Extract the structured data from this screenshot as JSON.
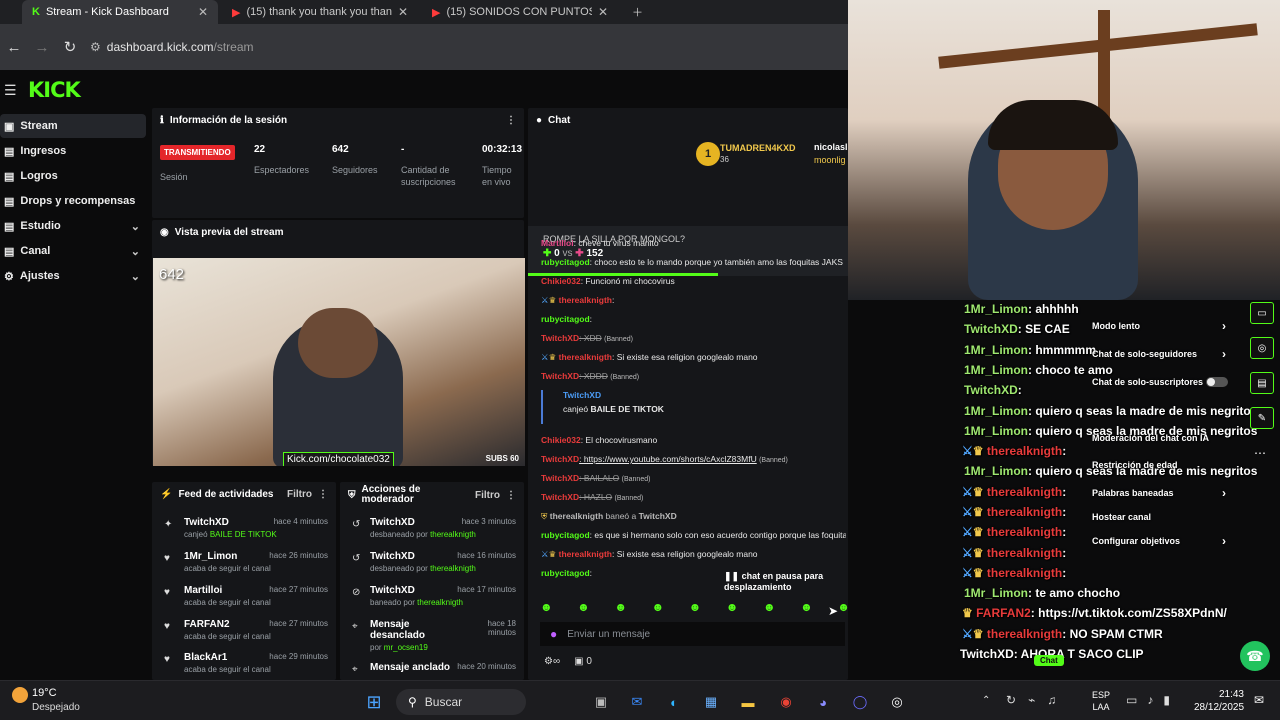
{
  "browser": {
    "tabs": [
      {
        "title": "Stream - Kick Dashboard",
        "active": true
      },
      {
        "title": "(15) thank you thank you thank",
        "active": false
      },
      {
        "title": "(15) SONIDOS CON PUNTOS DE",
        "active": false
      }
    ],
    "url_host": "dashboard.kick.com",
    "url_path": "/stream"
  },
  "app": {
    "logo": "KICK",
    "sidebar": [
      {
        "label": "Stream",
        "active": true
      },
      {
        "label": "Ingresos"
      },
      {
        "label": "Logros"
      },
      {
        "label": "Drops y recompensas"
      },
      {
        "label": "Estudio",
        "chevron": true
      },
      {
        "label": "Canal",
        "chevron": true
      },
      {
        "label": "Ajustes",
        "chevron": true
      }
    ]
  },
  "session": {
    "title": "Información de la sesión",
    "status": "TRANSMITIENDO",
    "status_label": "Sesión",
    "stats": [
      {
        "value": "22",
        "label": "Espectadores"
      },
      {
        "value": "642",
        "label": "Seguidores"
      },
      {
        "value": "-",
        "label": "Cantidad de suscripciones"
      },
      {
        "value": "00:32:13",
        "label": "Tiempo en vivo"
      }
    ]
  },
  "preview": {
    "title": "Vista previa del stream",
    "overlay_count": "642",
    "overlay_tag": "Kick.com/chocolate032",
    "subs": "SUBS 60"
  },
  "activity": {
    "title": "Feed de actividades",
    "filter": "Filtro",
    "items": [
      {
        "user": "TwitchXD",
        "time": "hace 4 minutos",
        "text": "canjeó",
        "extra": "BAILE DE TIKTOK"
      },
      {
        "user": "1Mr_Limon",
        "time": "hace 26 minutos",
        "text": "acaba de seguir el canal"
      },
      {
        "user": "Martilloi",
        "time": "hace 27 minutos",
        "text": "acaba de seguir el canal"
      },
      {
        "user": "FARFAN2",
        "time": "hace 27 minutos",
        "text": "acaba de seguir el canal"
      },
      {
        "user": "BlackAr1",
        "time": "hace 29 minutos",
        "text": "acaba de seguir el canal"
      }
    ]
  },
  "mod_actions": {
    "title": "Acciones de moderador",
    "filter": "Filtro",
    "items": [
      {
        "user": "TwitchXD",
        "time": "hace 3 minutos",
        "text": "desbaneado por",
        "by": "therealknigth"
      },
      {
        "user": "TwitchXD",
        "time": "hace 16 minutos",
        "text": "desbaneado por",
        "by": "therealknigth"
      },
      {
        "user": "TwitchXD",
        "time": "hace 17 minutos",
        "text": "baneado por",
        "by": "therealknigth"
      },
      {
        "user": "Mensaje desanclado",
        "time": "hace 18 minutos",
        "text": "por",
        "by": "mr_ocsen19"
      },
      {
        "user": "Mensaje anclado",
        "time": "hace 20 minutos",
        "text": "",
        "by": ""
      }
    ]
  },
  "chat": {
    "title": "Chat",
    "top_gifter": {
      "name": "TUMADREN4KXD",
      "count": "36"
    },
    "top_gifter2": "nicolasl",
    "top_gifter3": "moonlig",
    "poll": {
      "question": "ROMPE LA SILLA POR MONGOL?",
      "a": "0",
      "vs": "vs",
      "b": "152"
    },
    "messages": [
      {
        "user": "Martilloi",
        "text": ": cheve tu virus manito",
        "color": "pink"
      },
      {
        "user": "rubycitagod",
        "text": ": choco esto te lo mando porque yo también amo las foquitas JAKS",
        "color": "cyan"
      },
      {
        "user": "Chikie032",
        "text": ": Funcionó mi chocovirus",
        "color": "red"
      },
      {
        "user": "therealknigth",
        "text": ":",
        "color": "red"
      },
      {
        "user": "rubycitagod",
        "text": ":",
        "color": "cyan"
      },
      {
        "user": "TwitchXD",
        "text": ": XDD",
        "banned": "(Banned)",
        "color": "red"
      },
      {
        "user": "therealknigth",
        "text": ": Si existe esa religion googlealo mano",
        "color": "red"
      },
      {
        "user": "TwitchXD",
        "text": ": XDDD",
        "banned": "(Banned)",
        "color": "red"
      },
      {
        "user": "Chikie032",
        "text": ": El chocovirusmano",
        "color": "red"
      },
      {
        "user": "TwitchXD",
        "text": ": https://www.youtube.com/shorts/cAxclZ83MfU",
        "banned": "(Banned)",
        "color": "red"
      },
      {
        "user": "TwitchXD",
        "text": ": BAILALO",
        "banned": "(Banned)",
        "color": "red"
      },
      {
        "user": "TwitchXD",
        "text": ": HAZLO",
        "banned": "(Banned)",
        "color": "red"
      },
      {
        "user": "rubycitagod",
        "text": ": es que si hermano solo con eso acuerdo contigo porque las foquitas son re hermosas",
        "color": "cyan"
      },
      {
        "user": "therealknigth",
        "text": ": Si existe esa religion googlealo mano",
        "color": "red"
      },
      {
        "user": "rubycitagod",
        "text": ":",
        "color": "cyan"
      }
    ],
    "redeem": {
      "user": "TwitchXD",
      "text": "canjeó",
      "reward": "BAILE DE TIKTOK"
    },
    "ban_notice": {
      "actor": "therealknigth",
      "text": "baneó a",
      "target": "TwitchXD"
    },
    "paused": "chat en pausa para desplazamiento",
    "input_placeholder": "Enviar un mensaje",
    "footer_count": "0"
  },
  "overlay_chat": [
    {
      "user": "1Mr_Limon",
      "text": ": ahhhhh",
      "cls": "nm"
    },
    {
      "user": "TwitchXD",
      "text": ": SE CAE",
      "cls": "nm"
    },
    {
      "user": "1Mr_Limon",
      "text": ": hmmmmm",
      "cls": "nm"
    },
    {
      "user": "1Mr_Limon",
      "text": ": choco te amo",
      "cls": "nm"
    },
    {
      "user": "TwitchXD",
      "text": ":",
      "cls": "nm"
    },
    {
      "user": "1Mr_Limon",
      "text": ": quiero q seas la madre de mis negritos",
      "cls": "nm"
    },
    {
      "user": "1Mr_Limon",
      "text": ": quiero q seas la madre de mis negritos",
      "cls": "nm"
    },
    {
      "user": "therealknigth",
      "text": ":",
      "cls": "tr"
    },
    {
      "user": "1Mr_Limon",
      "text": ": quiero q seas la madre de mis negritos",
      "cls": "nm"
    },
    {
      "user": "therealknigth",
      "text": ":",
      "cls": "tr"
    },
    {
      "user": "therealknigth",
      "text": ":",
      "cls": "tr"
    },
    {
      "user": "therealknigth",
      "text": ":",
      "cls": "tr"
    },
    {
      "user": "therealknigth",
      "text": ":",
      "cls": "tr"
    },
    {
      "user": "therealknigth",
      "text": ":",
      "cls": "tr"
    },
    {
      "user": "1Mr_Limon",
      "text": ": te amo chocho",
      "cls": "nm"
    },
    {
      "user": "FARFAN2",
      "text": ": https://vt.tiktok.com/ZS58XPdnN/",
      "cls": "tr"
    },
    {
      "user": "therealknigth",
      "text": ": NO SPAM CTMR",
      "cls": "tr"
    },
    {
      "user": "TwitchXD",
      "text": ": AHORA T SACO CLIP",
      "cls": "nm"
    }
  ],
  "mod_menu": [
    {
      "label": "Modo lento",
      "arrow": true
    },
    {
      "label": "Chat de solo-seguidores",
      "arrow": true
    },
    {
      "label": "Chat de solo-suscriptores",
      "toggle": true
    },
    {
      "label": "Moderación del chat con IA",
      "arrow": false
    },
    {
      "label": "Restricción de edad",
      "arrow": false
    },
    {
      "label": "Palabras baneadas",
      "arrow": true
    },
    {
      "label": "Hostear canal",
      "arrow": false
    },
    {
      "label": "Configurar objetivos",
      "arrow": true
    }
  ],
  "overlay_chat_button": "Chat",
  "taskbar": {
    "weather_temp": "19°C",
    "weather_desc": "Despejado",
    "search": "Buscar",
    "lang": "ESP",
    "lang2": "LAA",
    "time": "21:43",
    "date": "28/12/2025"
  },
  "colors": {
    "kick_green": "#53fc18",
    "live_red": "#e4262a",
    "panel": "#151619"
  }
}
